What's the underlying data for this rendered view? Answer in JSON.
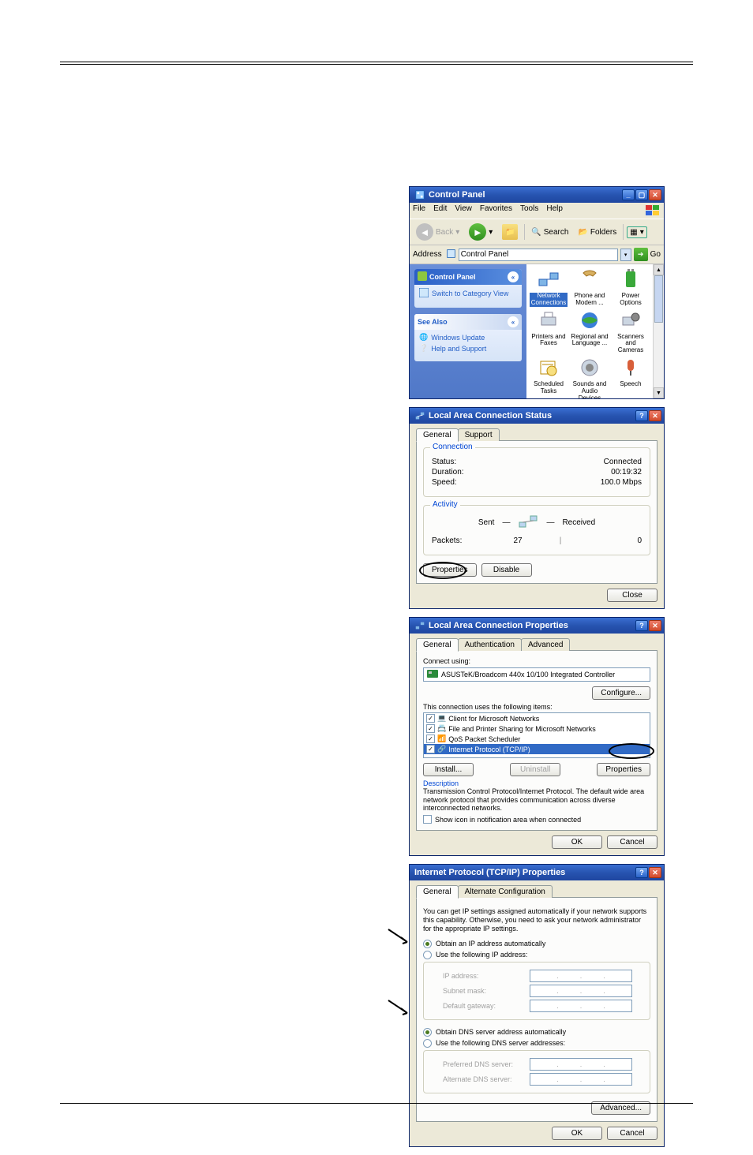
{
  "controlPanel": {
    "title": "Control Panel",
    "menu": [
      "File",
      "Edit",
      "View",
      "Favorites",
      "Tools",
      "Help"
    ],
    "toolbar": {
      "back": "Back",
      "search": "Search",
      "folders": "Folders"
    },
    "addressLabel": "Address",
    "addressValue": "Control Panel",
    "go": "Go",
    "sidePanelTitle": "Control Panel",
    "switchView": "Switch to Category View",
    "seeAlso": "See Also",
    "seeAlsoLinks": [
      "Windows Update",
      "Help and Support"
    ],
    "icons": [
      {
        "label": "Network Connections",
        "selected": true
      },
      {
        "label": "Phone and Modem ..."
      },
      {
        "label": "Power Options"
      },
      {
        "label": "Printers and Faxes"
      },
      {
        "label": "Regional and Language ..."
      },
      {
        "label": "Scanners and Cameras"
      },
      {
        "label": "Scheduled Tasks"
      },
      {
        "label": "Sounds and Audio Devices"
      },
      {
        "label": "Speech"
      }
    ]
  },
  "lacStatus": {
    "title": "Local Area Connection Status",
    "tabs": [
      "General",
      "Support"
    ],
    "connection": {
      "heading": "Connection",
      "statusLabel": "Status:",
      "statusValue": "Connected",
      "durationLabel": "Duration:",
      "durationValue": "00:19:32",
      "speedLabel": "Speed:",
      "speedValue": "100.0 Mbps"
    },
    "activity": {
      "heading": "Activity",
      "sent": "Sent",
      "received": "Received",
      "packetsLabel": "Packets:",
      "packetsSent": "27",
      "packetsReceived": "0"
    },
    "buttons": {
      "properties": "Properties",
      "disable": "Disable",
      "close": "Close"
    }
  },
  "lacProps": {
    "title": "Local Area Connection Properties",
    "tabs": [
      "General",
      "Authentication",
      "Advanced"
    ],
    "connectUsing": "Connect using:",
    "nic": "ASUSTeK/Broadcom 440x 10/100 Integrated Controller",
    "configure": "Configure...",
    "usesItems": "This connection uses the following items:",
    "items": [
      "Client for Microsoft Networks",
      "File and Printer Sharing for Microsoft Networks",
      "QoS Packet Scheduler",
      "Internet Protocol (TCP/IP)"
    ],
    "buttons": {
      "install": "Install...",
      "uninstall": "Uninstall",
      "properties": "Properties"
    },
    "descTitle": "Description",
    "descText": "Transmission Control Protocol/Internet Protocol. The default wide area network protocol that provides communication across diverse interconnected networks.",
    "showIcon": "Show icon in notification area when connected",
    "ok": "OK",
    "cancel": "Cancel"
  },
  "tcpip": {
    "title": "Internet Protocol (TCP/IP) Properties",
    "tabs": [
      "General",
      "Alternate Configuration"
    ],
    "intro": "You can get IP settings assigned automatically if your network supports this capability. Otherwise, you need to ask your network administrator for the appropriate IP settings.",
    "radioIpAuto": "Obtain an IP address automatically",
    "radioIpManual": "Use the following IP address:",
    "ipAddress": "IP address:",
    "subnet": "Subnet mask:",
    "gateway": "Default gateway:",
    "radioDnsAuto": "Obtain DNS server address automatically",
    "radioDnsManual": "Use the following DNS server addresses:",
    "preferredDns": "Preferred DNS server:",
    "alternateDns": "Alternate DNS server:",
    "advanced": "Advanced...",
    "ok": "OK",
    "cancel": "Cancel"
  }
}
